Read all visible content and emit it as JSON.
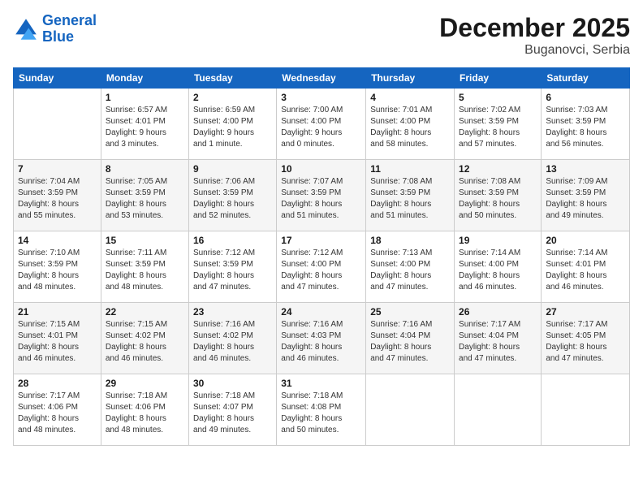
{
  "logo": {
    "line1": "General",
    "line2": "Blue"
  },
  "title": "December 2025",
  "location": "Buganovci, Serbia",
  "weekdays": [
    "Sunday",
    "Monday",
    "Tuesday",
    "Wednesday",
    "Thursday",
    "Friday",
    "Saturday"
  ],
  "weeks": [
    [
      {
        "day": "",
        "info": ""
      },
      {
        "day": "1",
        "info": "Sunrise: 6:57 AM\nSunset: 4:01 PM\nDaylight: 9 hours\nand 3 minutes."
      },
      {
        "day": "2",
        "info": "Sunrise: 6:59 AM\nSunset: 4:00 PM\nDaylight: 9 hours\nand 1 minute."
      },
      {
        "day": "3",
        "info": "Sunrise: 7:00 AM\nSunset: 4:00 PM\nDaylight: 9 hours\nand 0 minutes."
      },
      {
        "day": "4",
        "info": "Sunrise: 7:01 AM\nSunset: 4:00 PM\nDaylight: 8 hours\nand 58 minutes."
      },
      {
        "day": "5",
        "info": "Sunrise: 7:02 AM\nSunset: 3:59 PM\nDaylight: 8 hours\nand 57 minutes."
      },
      {
        "day": "6",
        "info": "Sunrise: 7:03 AM\nSunset: 3:59 PM\nDaylight: 8 hours\nand 56 minutes."
      }
    ],
    [
      {
        "day": "7",
        "info": "Sunrise: 7:04 AM\nSunset: 3:59 PM\nDaylight: 8 hours\nand 55 minutes."
      },
      {
        "day": "8",
        "info": "Sunrise: 7:05 AM\nSunset: 3:59 PM\nDaylight: 8 hours\nand 53 minutes."
      },
      {
        "day": "9",
        "info": "Sunrise: 7:06 AM\nSunset: 3:59 PM\nDaylight: 8 hours\nand 52 minutes."
      },
      {
        "day": "10",
        "info": "Sunrise: 7:07 AM\nSunset: 3:59 PM\nDaylight: 8 hours\nand 51 minutes."
      },
      {
        "day": "11",
        "info": "Sunrise: 7:08 AM\nSunset: 3:59 PM\nDaylight: 8 hours\nand 51 minutes."
      },
      {
        "day": "12",
        "info": "Sunrise: 7:08 AM\nSunset: 3:59 PM\nDaylight: 8 hours\nand 50 minutes."
      },
      {
        "day": "13",
        "info": "Sunrise: 7:09 AM\nSunset: 3:59 PM\nDaylight: 8 hours\nand 49 minutes."
      }
    ],
    [
      {
        "day": "14",
        "info": "Sunrise: 7:10 AM\nSunset: 3:59 PM\nDaylight: 8 hours\nand 48 minutes."
      },
      {
        "day": "15",
        "info": "Sunrise: 7:11 AM\nSunset: 3:59 PM\nDaylight: 8 hours\nand 48 minutes."
      },
      {
        "day": "16",
        "info": "Sunrise: 7:12 AM\nSunset: 3:59 PM\nDaylight: 8 hours\nand 47 minutes."
      },
      {
        "day": "17",
        "info": "Sunrise: 7:12 AM\nSunset: 4:00 PM\nDaylight: 8 hours\nand 47 minutes."
      },
      {
        "day": "18",
        "info": "Sunrise: 7:13 AM\nSunset: 4:00 PM\nDaylight: 8 hours\nand 47 minutes."
      },
      {
        "day": "19",
        "info": "Sunrise: 7:14 AM\nSunset: 4:00 PM\nDaylight: 8 hours\nand 46 minutes."
      },
      {
        "day": "20",
        "info": "Sunrise: 7:14 AM\nSunset: 4:01 PM\nDaylight: 8 hours\nand 46 minutes."
      }
    ],
    [
      {
        "day": "21",
        "info": "Sunrise: 7:15 AM\nSunset: 4:01 PM\nDaylight: 8 hours\nand 46 minutes."
      },
      {
        "day": "22",
        "info": "Sunrise: 7:15 AM\nSunset: 4:02 PM\nDaylight: 8 hours\nand 46 minutes."
      },
      {
        "day": "23",
        "info": "Sunrise: 7:16 AM\nSunset: 4:02 PM\nDaylight: 8 hours\nand 46 minutes."
      },
      {
        "day": "24",
        "info": "Sunrise: 7:16 AM\nSunset: 4:03 PM\nDaylight: 8 hours\nand 46 minutes."
      },
      {
        "day": "25",
        "info": "Sunrise: 7:16 AM\nSunset: 4:04 PM\nDaylight: 8 hours\nand 47 minutes."
      },
      {
        "day": "26",
        "info": "Sunrise: 7:17 AM\nSunset: 4:04 PM\nDaylight: 8 hours\nand 47 minutes."
      },
      {
        "day": "27",
        "info": "Sunrise: 7:17 AM\nSunset: 4:05 PM\nDaylight: 8 hours\nand 47 minutes."
      }
    ],
    [
      {
        "day": "28",
        "info": "Sunrise: 7:17 AM\nSunset: 4:06 PM\nDaylight: 8 hours\nand 48 minutes."
      },
      {
        "day": "29",
        "info": "Sunrise: 7:18 AM\nSunset: 4:06 PM\nDaylight: 8 hours\nand 48 minutes."
      },
      {
        "day": "30",
        "info": "Sunrise: 7:18 AM\nSunset: 4:07 PM\nDaylight: 8 hours\nand 49 minutes."
      },
      {
        "day": "31",
        "info": "Sunrise: 7:18 AM\nSunset: 4:08 PM\nDaylight: 8 hours\nand 50 minutes."
      },
      {
        "day": "",
        "info": ""
      },
      {
        "day": "",
        "info": ""
      },
      {
        "day": "",
        "info": ""
      }
    ]
  ]
}
